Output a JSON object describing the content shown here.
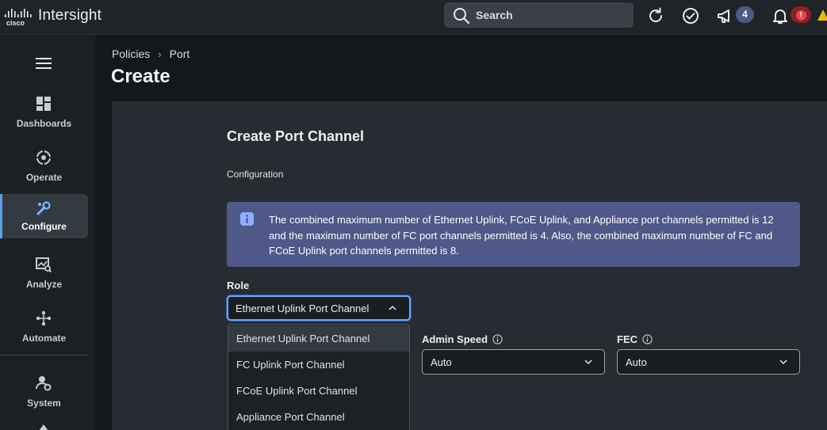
{
  "topbar": {
    "brand_logo_text": "cisco",
    "app_name": "Intersight",
    "search_placeholder": "Search",
    "announcements_count": "4",
    "alerts_count": "!",
    "icons": [
      "refresh-icon",
      "check-circle-icon",
      "megaphone-icon",
      "bell-icon",
      "warning-icon"
    ]
  },
  "sidebar": {
    "items": [
      {
        "label": "Dashboards",
        "icon": "dashboards-icon"
      },
      {
        "label": "Operate",
        "icon": "operate-icon"
      },
      {
        "label": "Configure",
        "icon": "configure-icon",
        "active": true
      },
      {
        "label": "Analyze",
        "icon": "analyze-icon"
      },
      {
        "label": "Automate",
        "icon": "automate-icon"
      },
      {
        "label": "System",
        "icon": "system-icon"
      }
    ]
  },
  "breadcrumb": {
    "parent": "Policies",
    "current": "Port"
  },
  "page": {
    "title": "Create"
  },
  "form": {
    "section_title": "Create Port Channel",
    "subsection": "Configuration",
    "info_text": "The combined maximum number of Ethernet Uplink, FCoE Uplink, and Appliance port channels permitted is 12 and the maximum number of FC port channels permitted is 4. Also, the combined maximum number of FC and FCoE Uplink port channels permitted is 8.",
    "role": {
      "label": "Role",
      "value": "Ethernet Uplink Port Channel",
      "options": [
        "Ethernet Uplink Port Channel",
        "FC Uplink Port Channel",
        "FCoE Uplink Port Channel",
        "Appliance Port Channel"
      ]
    },
    "admin_speed": {
      "label": "Admin Speed",
      "value": "Auto"
    },
    "fec": {
      "label": "FEC",
      "value": "Auto"
    }
  },
  "colors": {
    "accent": "#6aa8ff",
    "info_bg": "#4f5888",
    "alert": "#c4262e",
    "badge": "#4f5888"
  }
}
